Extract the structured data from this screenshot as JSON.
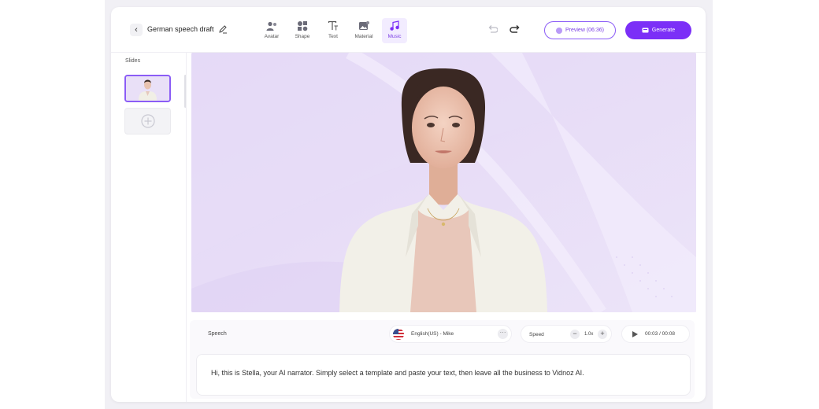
{
  "header": {
    "back_glyph": "‹",
    "title": "German speech draft",
    "tools": [
      {
        "label": "Avatar"
      },
      {
        "label": "Shape"
      },
      {
        "label": "Text"
      },
      {
        "label": "Material"
      },
      {
        "label": "Music",
        "active": true
      }
    ],
    "preview_label": "Preview (06:36)",
    "generate_label": "Generate"
  },
  "slides": {
    "label": "Slides"
  },
  "speech": {
    "label": "Speech",
    "voice": "English(US) - Mike",
    "speed_label": "Speed",
    "speed_value": "1.0x",
    "time": "00:03 / 00:08",
    "script": "Hi, this is Stella, your AI narrator. Simply select a template and paste your text, then leave all the business to Vidnoz AI."
  },
  "colors": {
    "accent": "#7b2ff7",
    "accent_light": "#f2ecff",
    "canvas_bg": "#e6dbf7"
  },
  "icons": {
    "back": "chevron-left-icon",
    "edit": "pencil-icon",
    "avatar": "avatar-icon",
    "shape": "shape-icon",
    "text": "text-icon",
    "material": "image-icon",
    "music": "music-note-icon",
    "undo": "undo-icon",
    "redo": "redo-icon",
    "add_slide": "plus-circle-icon",
    "play": "play-icon"
  }
}
